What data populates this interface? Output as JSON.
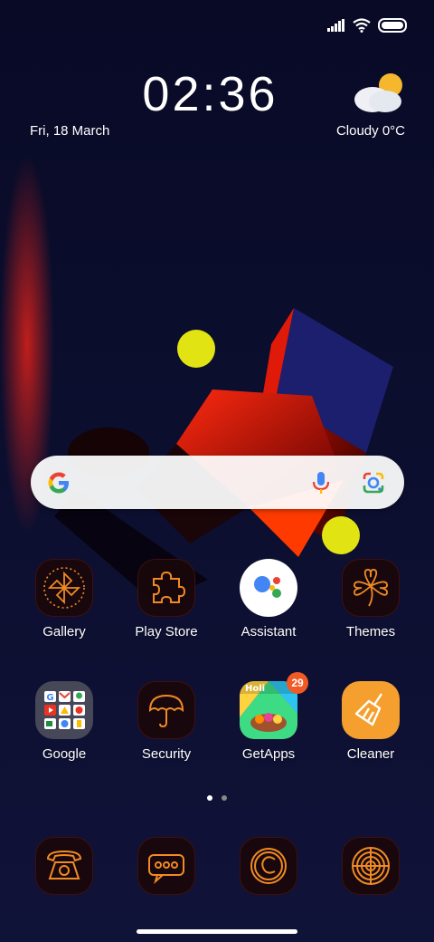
{
  "status_bar": {
    "icons": [
      "signal-icon",
      "wifi-icon",
      "battery-icon"
    ],
    "battery_level": 1.0
  },
  "clock": {
    "time": "02:36",
    "date": "Fri, 18 March"
  },
  "weather": {
    "label": "Cloudy  0°C",
    "icon": "cloudy-sun-icon"
  },
  "search_bar": {
    "icons": [
      "google-g-icon",
      "microphone-icon",
      "google-lens-icon"
    ]
  },
  "apps_row1": [
    {
      "label": "Gallery",
      "icon": "gallery-pinwheel-icon"
    },
    {
      "label": "Play Store",
      "icon": "puzzle-piece-icon"
    },
    {
      "label": "Assistant",
      "icon": "google-assistant-icon"
    },
    {
      "label": "Themes",
      "icon": "clover-icon"
    }
  ],
  "apps_row2": [
    {
      "label": "Google",
      "icon": "google-folder-icon"
    },
    {
      "label": "Security",
      "icon": "umbrella-icon"
    },
    {
      "label": "GetApps",
      "icon": "getapps-icon",
      "badge": "29",
      "banner": "Holi"
    },
    {
      "label": "Cleaner",
      "icon": "broom-icon"
    }
  ],
  "dock": [
    {
      "icon": "phone-icon"
    },
    {
      "icon": "messages-icon"
    },
    {
      "icon": "browser-icon"
    },
    {
      "icon": "camera-icon"
    }
  ],
  "page_indicator": {
    "pages": 2,
    "current": 1
  },
  "colors": {
    "background": "#0a0c2a",
    "accent_orange": "#f08a24",
    "badge": "#f15a24",
    "yellow_dot": "#e1e313"
  }
}
